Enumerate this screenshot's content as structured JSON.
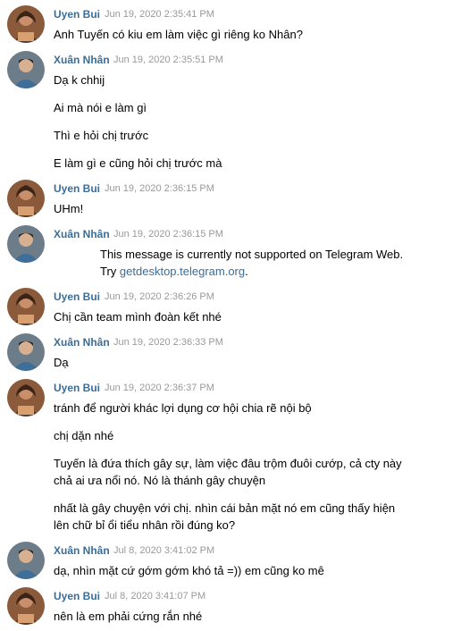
{
  "messages": [
    {
      "author": "Uyen Bui",
      "time": "Jun 19, 2020 2:35:41 PM",
      "lines": [
        "Anh Tuyến có kiu em làm việc gì riêng ko Nhân?"
      ]
    },
    {
      "author": "Xuân Nhân",
      "time": "Jun 19, 2020 2:35:51 PM",
      "lines": [
        "Dạ k chhij",
        "Ai mà nói e làm gì",
        "Thì e hỏi chị trước",
        "E làm gì e cũng hỏi chị trước mà"
      ]
    },
    {
      "author": "Uyen Bui",
      "time": "Jun 19, 2020 2:36:15 PM",
      "lines": [
        "UHm!"
      ]
    },
    {
      "author": "Xuân Nhân",
      "time": "Jun 19, 2020 2:36:15 PM",
      "unsupported": {
        "line1": "This message is currently not supported on Telegram Web.",
        "try_label": "Try",
        "link": "getdesktop.telegram.org",
        "period": "."
      }
    },
    {
      "author": "Uyen Bui",
      "time": "Jun 19, 2020 2:36:26 PM",
      "lines": [
        "Chị cần team mình đoàn kết nhé"
      ]
    },
    {
      "author": "Xuân Nhân",
      "time": "Jun 19, 2020 2:36:33 PM",
      "lines": [
        "Dạ"
      ]
    },
    {
      "author": "Uyen Bui",
      "time": "Jun 19, 2020 2:36:37 PM",
      "lines": [
        "tránh để người khác lợi dụng cơ hội chia rẽ nội bộ",
        "chị dặn nhé",
        "Tuyến là đứa thích gây sự, làm việc đâu trộm đuôi cướp, cả cty này chả ai ưa nổi nó. Nó là thánh gây chuyện",
        "nhất là gây chuyện với chị. nhìn cái bản mặt nó em cũng thấy hiện lên chữ bỉ ổi tiểu nhân rồi đúng ko?"
      ]
    },
    {
      "author": "Xuân Nhân",
      "time": "Jul 8, 2020 3:41:02 PM",
      "lines": [
        "dạ, nhìn mặt cứ gớm gớm khó tả =)) em cũng ko mê"
      ]
    },
    {
      "author": "Uyen Bui",
      "time": "Jul 8, 2020 3:41:07 PM",
      "lines": [
        "nên là em phải cứng rắn nhé"
      ]
    }
  ]
}
